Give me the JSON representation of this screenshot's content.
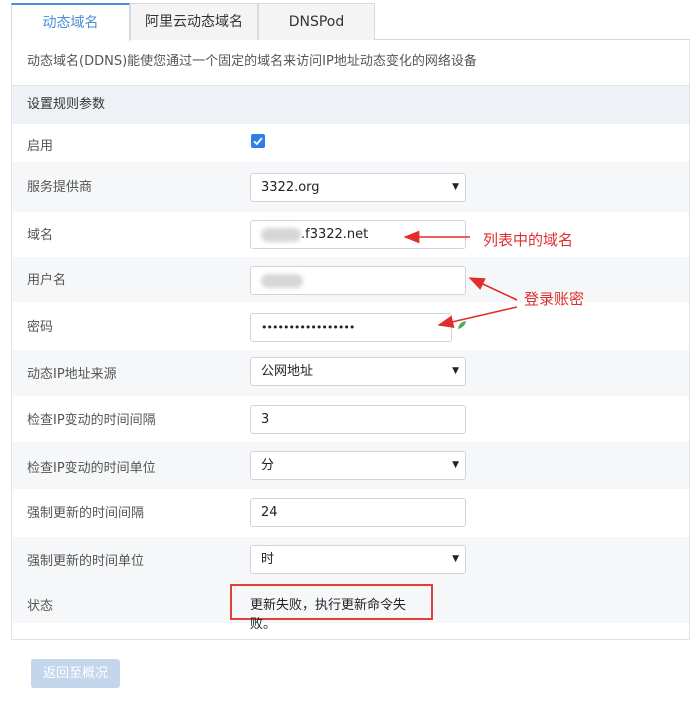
{
  "tabs": [
    {
      "label": "动态域名",
      "active": true
    },
    {
      "label": "阿里云动态域名",
      "active": false
    },
    {
      "label": "DNSPod",
      "active": false
    }
  ],
  "description": "动态域名(DDNS)能使您通过一个固定的域名来访问IP地址动态变化的网络设备",
  "section_title": "设置规则参数",
  "form": {
    "enable_label": "启用",
    "enable_checked": true,
    "provider_label": "服务提供商",
    "provider_value": "3322.org",
    "domain_label": "域名",
    "domain_value": ".f3322.net",
    "username_label": "用户名",
    "password_label": "密码",
    "password_value": "•••••••••••••••••",
    "ip_source_label": "动态IP地址来源",
    "ip_source_value": "公网地址",
    "check_interval_label": "检查IP变动的时间间隔",
    "check_interval_value": "3",
    "check_unit_label": "检查IP变动的时间单位",
    "check_unit_value": "分",
    "force_interval_label": "强制更新的时间间隔",
    "force_interval_value": "24",
    "force_unit_label": "强制更新的时间单位",
    "force_unit_value": "时",
    "status_label": "状态",
    "status_value": "更新失败，执行更新命令失败。"
  },
  "annotations": {
    "domain_note": "列表中的域名",
    "account_note": "登录账密"
  },
  "back_button": "返回至概况",
  "colors": {
    "accent": "#4a8ed8",
    "annotation_red": "#e02e2e",
    "checkbox_blue": "#2d7ee8"
  }
}
